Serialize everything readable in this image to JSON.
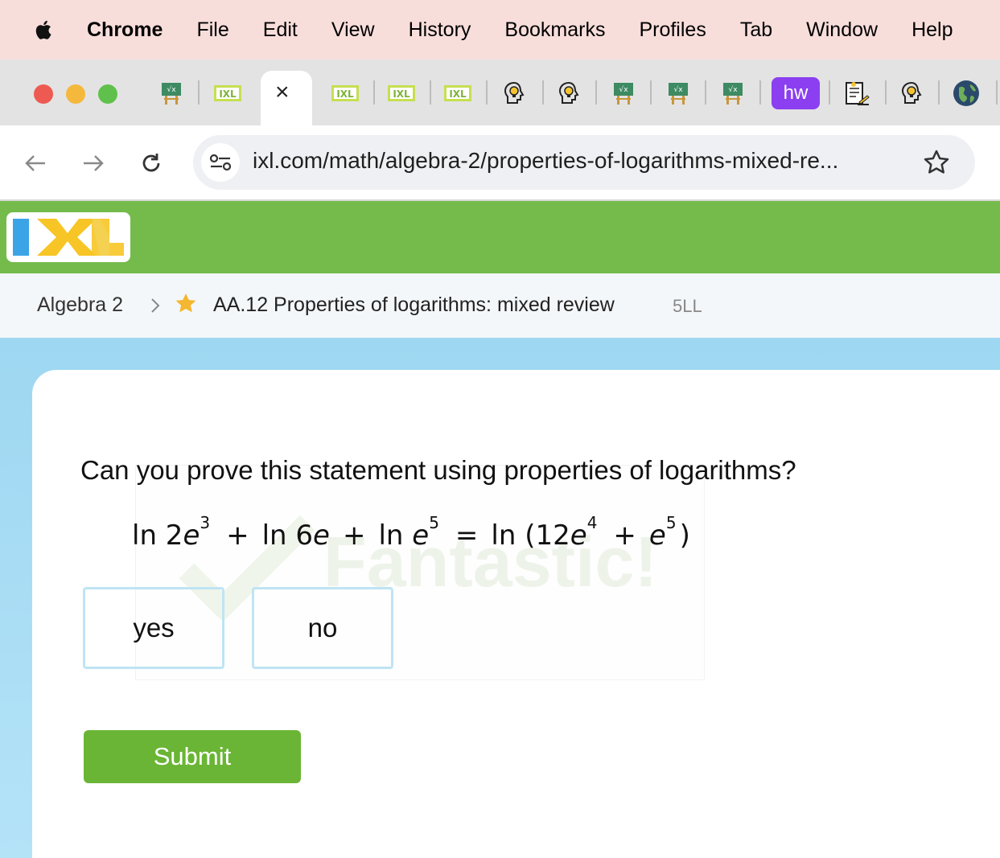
{
  "menubar": {
    "app_name": "Chrome",
    "items": [
      "File",
      "Edit",
      "View",
      "History",
      "Bookmarks",
      "Profiles",
      "Tab",
      "Window",
      "Help"
    ]
  },
  "tabs": {
    "icons": [
      "chalkboard-icon",
      "ixl-favicon",
      "close-tab-icon",
      "ixl-favicon",
      "ixl-favicon",
      "ixl-favicon",
      "lightbulb-head-icon",
      "lightbulb-head-icon",
      "chalkboard-icon",
      "chalkboard-icon",
      "chalkboard-icon",
      "hw-favicon",
      "document-pencil-icon",
      "lightbulb-head-icon",
      "globe-icon"
    ],
    "hw_label": "hw",
    "active_close": "×"
  },
  "address_bar": {
    "url": "ixl.com/math/algebra-2/properties-of-logarithms-mixed-re..."
  },
  "ixl": {
    "logo_letters": "IXL",
    "colors": {
      "header_green": "#74bb4b",
      "logo_blue": "#3ba4e6",
      "logo_yellow": "#f7c525",
      "submit_green": "#6ab535"
    }
  },
  "breadcrumb": {
    "subject": "Algebra 2",
    "skill": "AA.12 Properties of logarithms: mixed review",
    "code": "5LL"
  },
  "question": {
    "prompt": "Can you prove this statement using properties of logarithms?",
    "equation": {
      "t1": "ln 2",
      "t1_var": "e",
      "t1_exp": "3",
      "plus1": "+",
      "t2": "ln 6",
      "t2_var": "e",
      "plus2": "+",
      "t3": "ln ",
      "t3_var": "e",
      "t3_exp": "5",
      "equals": "=",
      "rhs_open": "ln (12",
      "rhs_var1": "e",
      "rhs_exp1": "4",
      "plus3": "+",
      "rhs_var2": "e",
      "rhs_exp2": "5",
      "rhs_close": ")"
    },
    "watermark": "Fantastic!",
    "options": [
      "yes",
      "no"
    ],
    "submit_label": "Submit"
  }
}
